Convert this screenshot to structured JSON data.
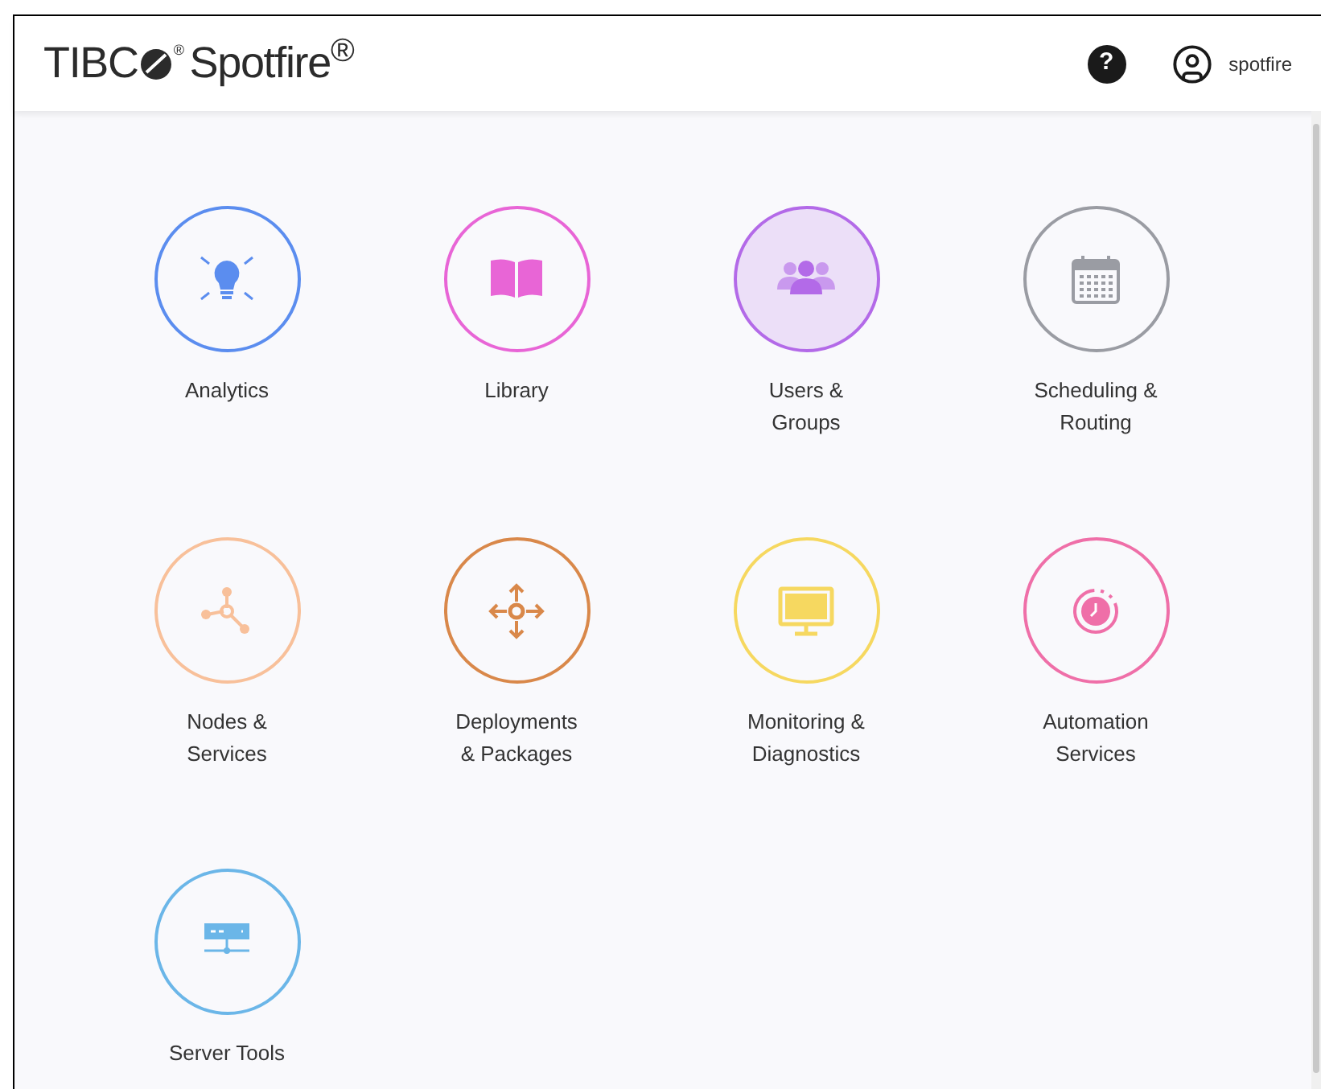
{
  "header": {
    "logo": {
      "prefix": "TIBC",
      "mark": "®",
      "name": "Spotfire$^{®}$"
    },
    "help_button": {
      "label": "?"
    },
    "user": {
      "name": "spotfire"
    }
  },
  "tiles": [
    {
      "kind": "analytics",
      "lines": [
        "Analytics"
      ],
      "color": "#5b8def",
      "selected": false
    },
    {
      "kind": "library",
      "lines": [
        "Library"
      ],
      "color": "#e865d6",
      "selected": false
    },
    {
      "kind": "users",
      "lines": [
        "Users &",
        "Groups"
      ],
      "color": "#b36ae8",
      "selected": true
    },
    {
      "kind": "scheduling",
      "lines": [
        "Scheduling &",
        "Routing"
      ],
      "color": "#9a9ca3",
      "selected": false
    },
    {
      "kind": "nodes",
      "lines": [
        "Nodes &",
        "Services"
      ],
      "color": "#f8c09a",
      "selected": false
    },
    {
      "kind": "deployments",
      "lines": [
        "Deployments",
        "& Packages"
      ],
      "color": "#d9884a",
      "selected": false
    },
    {
      "kind": "monitoring",
      "lines": [
        "Monitoring &",
        "Diagnostics"
      ],
      "color": "#f6d860",
      "selected": false
    },
    {
      "kind": "automation",
      "lines": [
        "Automation",
        "Services"
      ],
      "color": "#ef6fa8",
      "selected": false
    },
    {
      "kind": "server",
      "lines": [
        "Server Tools"
      ],
      "color": "#6bb6e8",
      "selected": false
    }
  ]
}
